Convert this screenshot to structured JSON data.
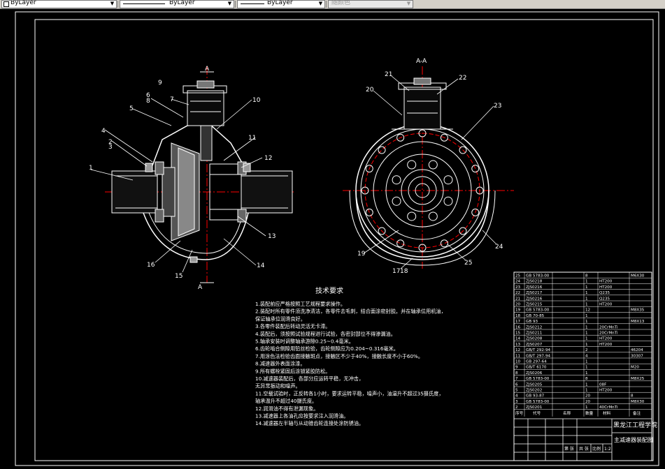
{
  "toolbar": {
    "color_control": "ByLayer",
    "linetype_control": "ByLayer",
    "lineweight_control": "ByLayer",
    "plotstyle_control": "随颜色"
  },
  "drawing": {
    "section_label": "A-A",
    "section_mark": "A",
    "tech_title": "技术要求",
    "tech_requirements": [
      "1.装配前应严格按照工艺规程要求操作。",
      "2.装配时所有零件须洗净清洁，各零件去毛刺，结合面涂密封胶。并在轴承位用机油，",
      "  保证轴承位润滑良好。",
      "3.各零件装配后转动灵活无卡滞。",
      "4.装配后，须按照试验规程进行试验，各密封部位不得渗漏油。",
      "5.轴承安装时调整轴承游隙0.25~0.4毫米。",
      "6.齿轮啮合侧隙用铅丝检验，齿轮侧隙应为0.204~0.316毫米。",
      "7.用涂色法检验齿面接触斑点，接触区不少于40%，接触长度不小于60%。",
      "8.减速器外表面涂漆。",
      "9.所有螺栓紧固后涂锁紧胶防松。",
      "10.减速器装配后，各部分应运转平稳，无冲击，",
      "   无异常振动和噪声。",
      "11.空载试验时，正反转各1小时，要求运转平稳，噪声小，油温升不超过35摄氏度，",
      "   轴承温升不超过40摄氏度。",
      "12.润滑油不得有泄漏现象。",
      "13.减速器上各油孔应按要求注入润滑油。",
      "14.减速器左半轴与从动锥齿轮连接处涂防锈油。"
    ],
    "balloons_left": [
      "1",
      "2",
      "3",
      "4",
      "5",
      "6",
      "7",
      "8",
      "9",
      "10",
      "11",
      "12",
      "13",
      "14",
      "15",
      "16"
    ],
    "balloons_right": [
      "17",
      "18",
      "19",
      "20",
      "21",
      "22",
      "23",
      "24",
      "25"
    ],
    "bom_rows": [
      {
        "no": "25",
        "code": "GB 5783-00",
        "qty": "8",
        "mat": "",
        "note": "M6X30"
      },
      {
        "no": "24",
        "code": "ZJS0218",
        "qty": "1",
        "mat": "HT200",
        "note": ""
      },
      {
        "no": "23",
        "code": "ZJS0216",
        "qty": "1",
        "mat": "HT200",
        "note": ""
      },
      {
        "no": "22",
        "code": "ZJS0217",
        "qty": "1",
        "mat": "Q235",
        "note": ""
      },
      {
        "no": "21",
        "code": "ZJS0216",
        "qty": "1",
        "mat": "Q235",
        "note": ""
      },
      {
        "no": "20",
        "code": "ZJS0215",
        "qty": "1",
        "mat": "HT200",
        "note": ""
      },
      {
        "no": "19",
        "code": "GB 5783-00",
        "qty": "12",
        "mat": "",
        "note": "M8X35"
      },
      {
        "no": "18",
        "code": "GB 70-85",
        "qty": "1",
        "mat": "",
        "note": ""
      },
      {
        "no": "17",
        "code": "GB 93",
        "qty": "1",
        "mat": "",
        "note": "M8X13"
      },
      {
        "no": "16",
        "code": "ZJS0212",
        "qty": "1",
        "mat": "20CrMnTi",
        "note": ""
      },
      {
        "no": "15",
        "code": "ZJS0211",
        "qty": "1",
        "mat": "20CrMnTi",
        "note": ""
      },
      {
        "no": "14",
        "code": "ZJS0208",
        "qty": "1",
        "mat": "HT200",
        "note": ""
      },
      {
        "no": "13",
        "code": "ZJS0207",
        "qty": "1",
        "mat": "HT200",
        "note": ""
      },
      {
        "no": "12",
        "code": "GB/T 292-94",
        "qty": "2",
        "mat": "",
        "note": "46204"
      },
      {
        "no": "11",
        "code": "GB/T 297-94",
        "qty": "4",
        "mat": "",
        "note": "30307"
      },
      {
        "no": "10",
        "code": "GB 297-64",
        "qty": "1",
        "mat": "",
        "note": ""
      },
      {
        "no": "9",
        "code": "GB/T 6170",
        "qty": "1",
        "mat": "",
        "note": "M20"
      },
      {
        "no": "8",
        "code": "ZJS0206",
        "qty": "1",
        "mat": "",
        "note": ""
      },
      {
        "no": "7",
        "code": "GB 5783-00",
        "qty": "8",
        "mat": "",
        "note": "M8X25"
      },
      {
        "no": "6",
        "code": "ZJS0205",
        "qty": "1",
        "mat": "08F",
        "note": ""
      },
      {
        "no": "5",
        "code": "ZJS0202",
        "qty": "1",
        "mat": "HT200",
        "note": ""
      },
      {
        "no": "4",
        "code": "GB 93-87",
        "qty": "20",
        "mat": "",
        "note": "8"
      },
      {
        "no": "3",
        "code": "GB 5783-00",
        "qty": "20",
        "mat": "",
        "note": "M8X30"
      },
      {
        "no": "2",
        "code": "ZJS0201",
        "qty": "1",
        "mat": "40CrMnTi",
        "note": ""
      }
    ],
    "bom_header": {
      "no": "序号",
      "code": "代号",
      "name": "名称",
      "qty": "数量",
      "mat": "材料",
      "note": "备注"
    },
    "title_block": {
      "school": "黑龙江工程学院",
      "drawing_name": "主减速器装配图",
      "scale_label": "比例",
      "scale": "1:2",
      "sheet_label": "第 张",
      "sheets_label": "共 张"
    }
  }
}
